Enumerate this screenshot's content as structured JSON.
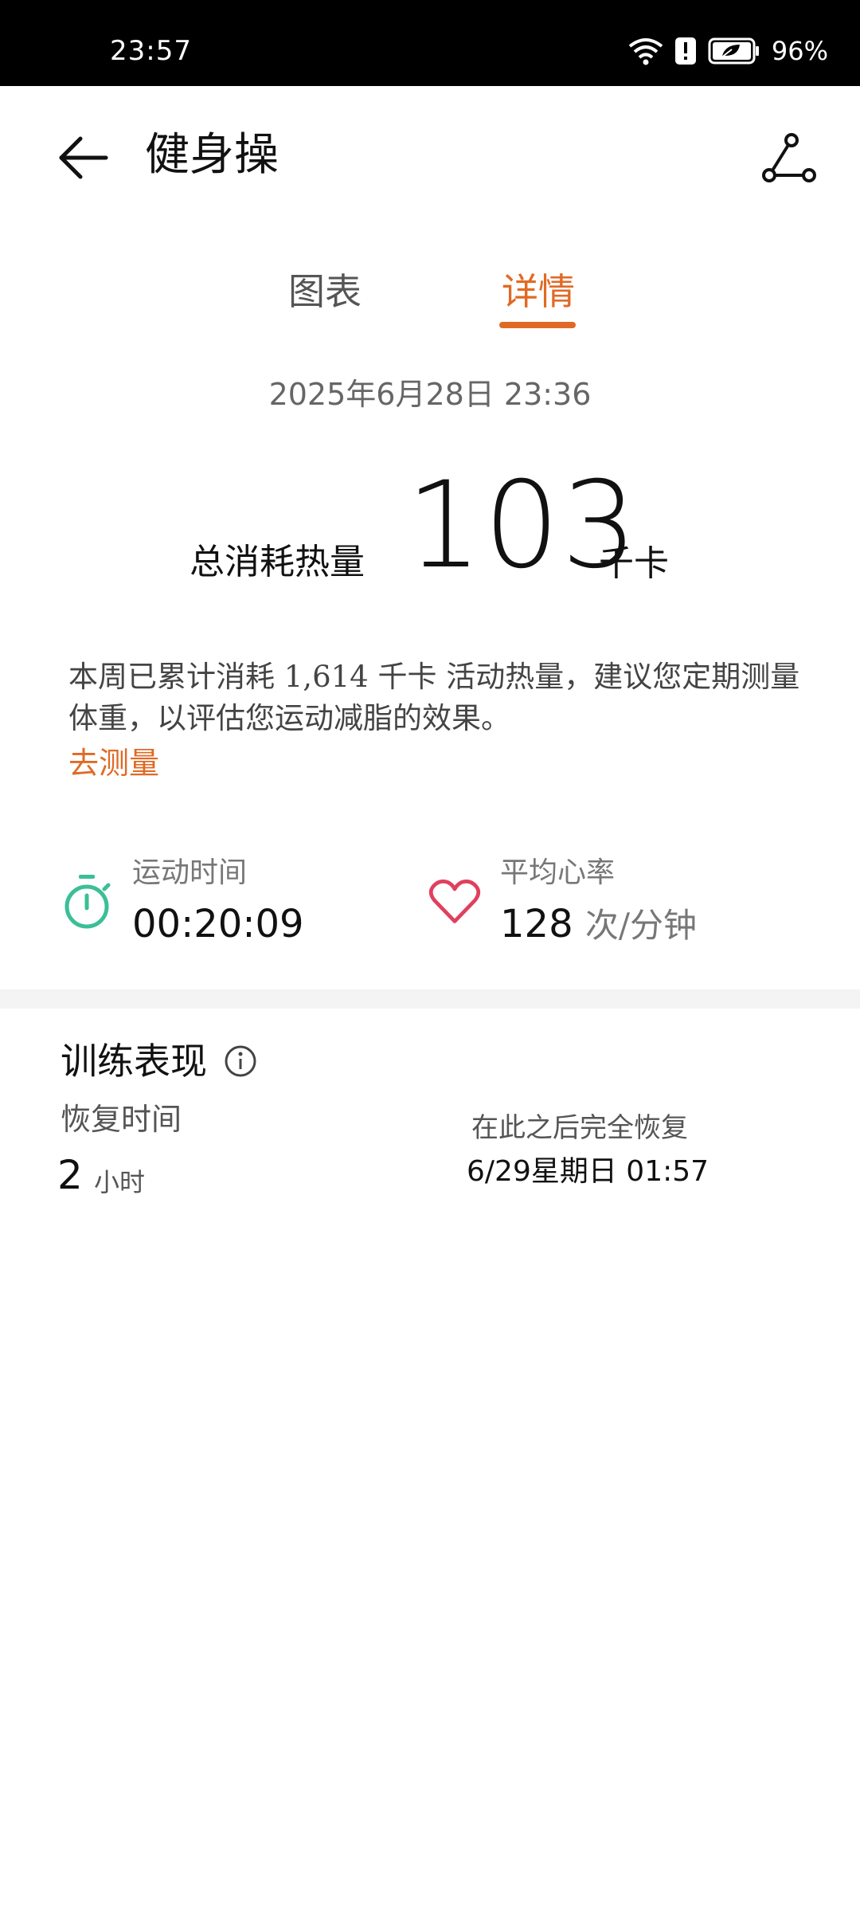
{
  "status_bar": {
    "time": "23:57",
    "battery": "96%"
  },
  "header": {
    "title": "健身操"
  },
  "tabs": [
    {
      "label": "图表"
    },
    {
      "label": "详情"
    }
  ],
  "session": {
    "datetime": "2025年6月28日  23:36",
    "total_calories_label": "总消耗热量",
    "total_calories_value": "103",
    "total_calories_unit": "千卡"
  },
  "weekly_note": {
    "text": "本周已累计消耗 1,614 千卡 活动热量，建议您定期测量体重，以评估您运动减脂的效果。",
    "link": "去测量"
  },
  "stats": {
    "duration_label": "运动时间",
    "duration_value": "00:20:09",
    "heart_rate_label": "平均心率",
    "heart_rate_value": "128",
    "heart_rate_unit": "次/分钟"
  },
  "training": {
    "title": "训练表现",
    "recovery_label": "恢复时间",
    "recovery_value": "2",
    "recovery_unit": "小时",
    "full_recovery_label": "在此之后完全恢复",
    "full_recovery_time": "6/29星期日  01:57"
  },
  "colors": {
    "accent": "#e06a25",
    "stopwatch": "#3bbf96",
    "heart": "#e0405e"
  }
}
